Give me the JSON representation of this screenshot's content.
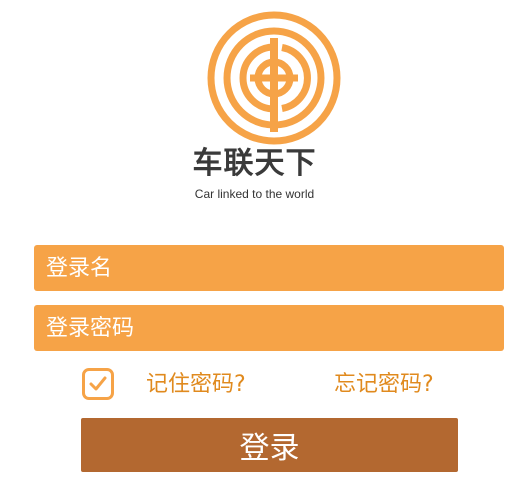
{
  "brand": {
    "name": "车联天下",
    "tagline": "Car linked to the world",
    "logo_icon": "steering-wheel-logo-icon",
    "color": "#f6a347"
  },
  "login_form": {
    "username_placeholder": "登录名",
    "password_placeholder": "登录密码",
    "remember_checked": true,
    "remember_label": "记住密码?",
    "forgot_label": "忘记密码?",
    "submit_label": "登录"
  },
  "colors": {
    "field_bg": "#f6a347",
    "link_text": "#e08a1e",
    "button_bg": "#b36830",
    "brand_text": "#3a3a3a"
  }
}
